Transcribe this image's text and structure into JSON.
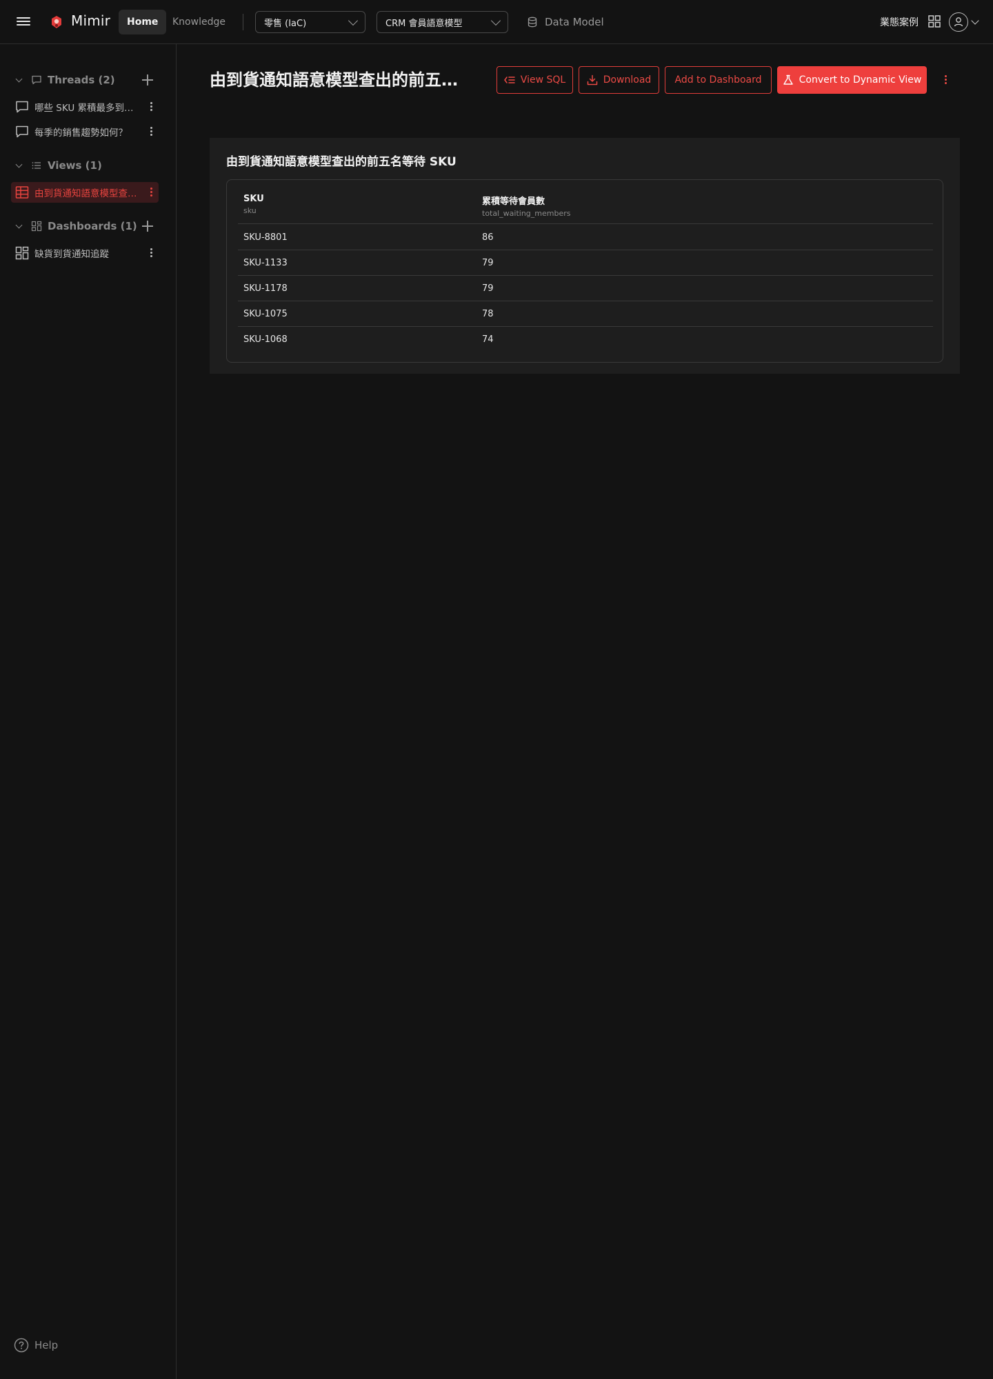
{
  "header": {
    "brand": "Mimir",
    "tabs": [
      {
        "label": "Home",
        "active": true
      },
      {
        "label": "Knowledge",
        "active": false
      }
    ],
    "project_select": "零售 (IaC)",
    "model_select": "CRM 會員語意模型",
    "data_model_label": "Data Model",
    "right_label": "業態案例"
  },
  "sidebar": {
    "threads": {
      "title": "Threads (2)",
      "items": [
        "哪些 SKU 累積最多到貨通知",
        "每季的銷售趨勢如何？"
      ]
    },
    "views": {
      "title": "Views (1)",
      "items": [
        "由到貨通知語意模型查出的前五名等待 SKU"
      ]
    },
    "dashboards": {
      "title": "Dashboards (1)",
      "items": [
        "缺貨到貨通知追蹤"
      ]
    },
    "help_label": "Help"
  },
  "main": {
    "title": "由到貨通知語意模型查出的前五名等待 SKU",
    "buttons": {
      "view_sql": "View SQL",
      "download": "Download",
      "add_dashboard": "Add to Dashboard",
      "convert": "Convert to Dynamic View"
    },
    "card_title": "由到貨通知語意模型查出的前五名等待 SKU",
    "table": {
      "columns": [
        {
          "label": "SKU",
          "field": "sku"
        },
        {
          "label": "累積等待會員數",
          "field": "total_waiting_members"
        }
      ],
      "rows": [
        [
          "SKU-8801",
          "86"
        ],
        [
          "SKU-1133",
          "79"
        ],
        [
          "SKU-1178",
          "79"
        ],
        [
          "SKU-1075",
          "78"
        ],
        [
          "SKU-1068",
          "74"
        ]
      ]
    }
  },
  "colors": {
    "accent": "#ee3f3d",
    "background": "#131313",
    "card": "#1e1e1e"
  },
  "icons": {
    "menu": "hamburger-icon",
    "logo": "mimir-logo-icon",
    "database": "database-icon",
    "apps": "grid-icon",
    "user": "user-icon",
    "thread": "chat-bubble-icon",
    "view": "table-icon",
    "dashboard": "dashboard-icon",
    "help": "help-icon"
  }
}
